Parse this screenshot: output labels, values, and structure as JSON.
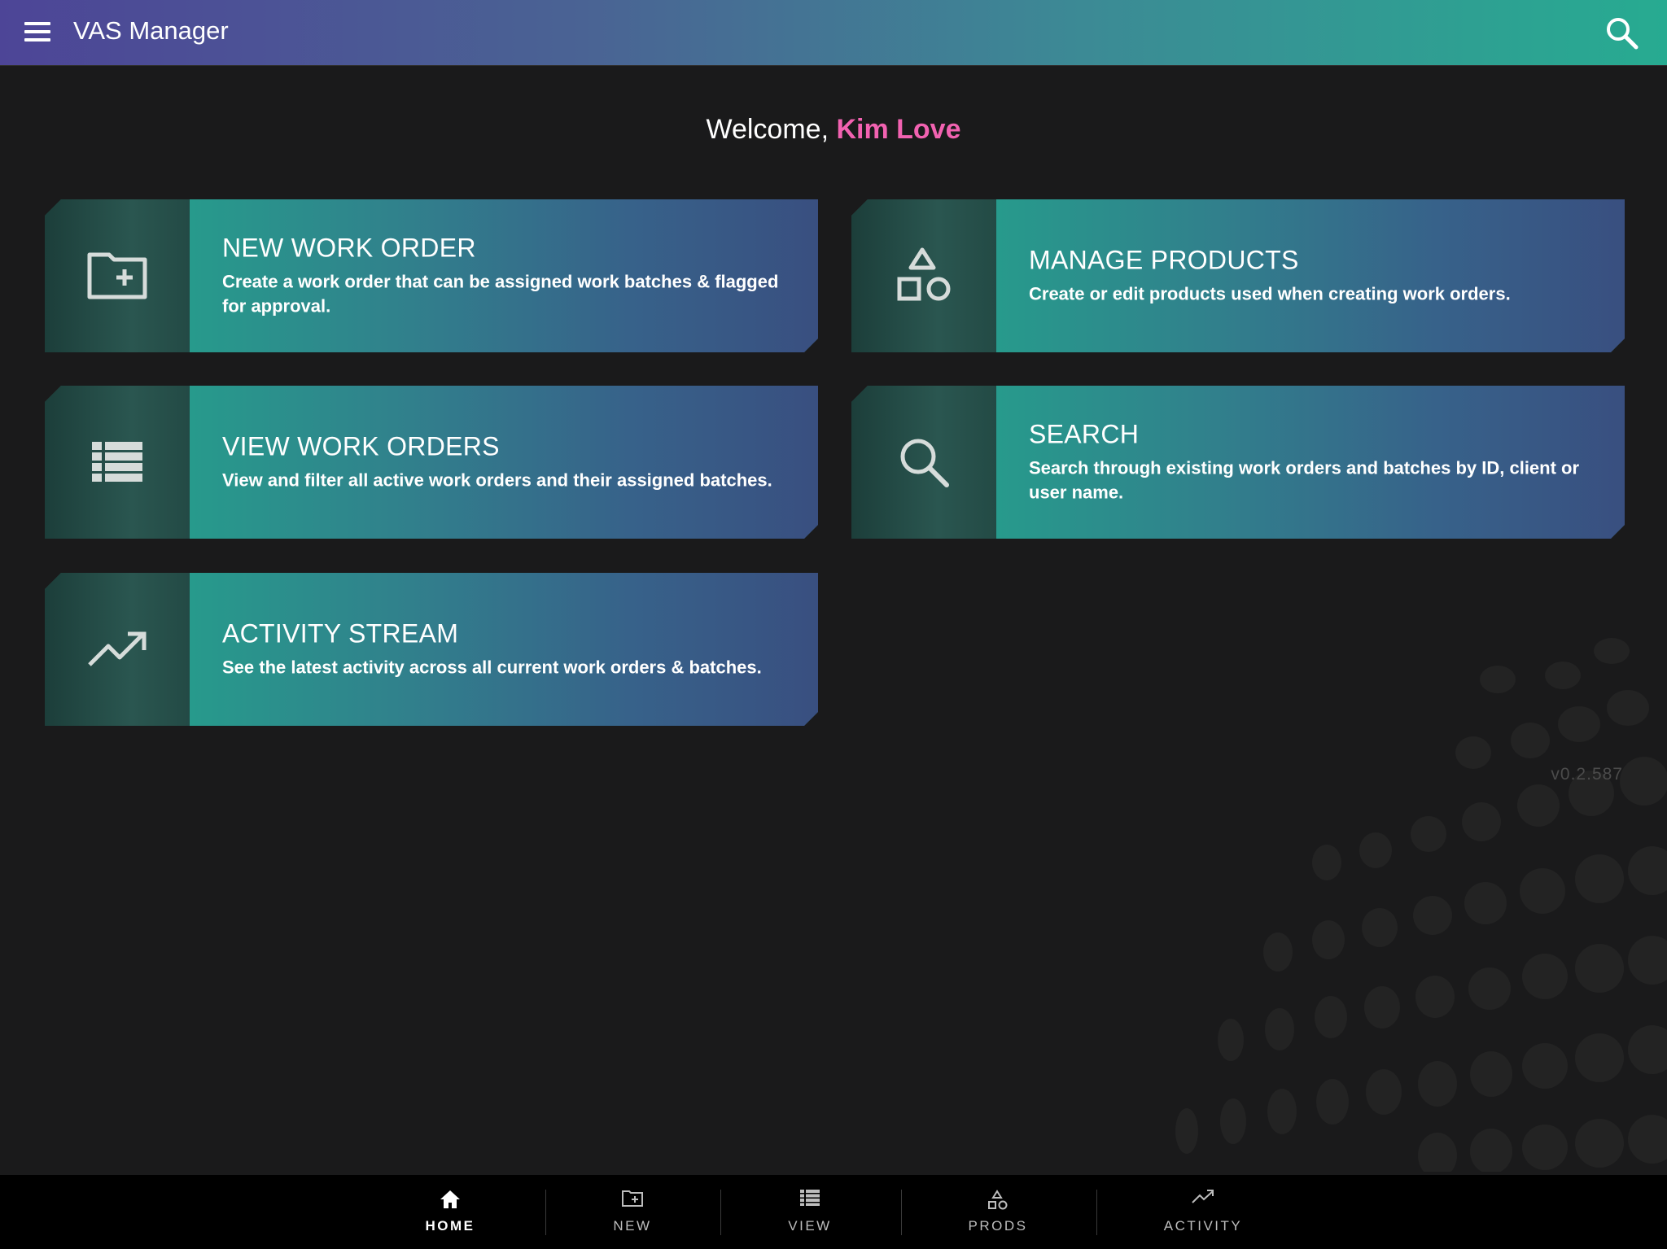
{
  "header": {
    "app_title": "VAS Manager",
    "menu_icon": "hamburger-menu-icon",
    "search_icon": "search-icon",
    "gradient_colors": [
      "#4d4597",
      "#27ab91"
    ]
  },
  "welcome": {
    "prefix": "Welcome,",
    "user_name": "Kim Love",
    "user_color": "#f262b1"
  },
  "tiles": [
    {
      "icon": "folder-plus-icon",
      "title": "NEW WORK ORDER",
      "description": "Create a work order that can be assigned work batches & flagged for approval."
    },
    {
      "icon": "shapes-icon",
      "title": "MANAGE PRODUCTS",
      "description": "Create or edit products used when creating work orders."
    },
    {
      "icon": "list-icon",
      "title": "VIEW WORK ORDERS",
      "description": "View and filter all active work orders and their assigned batches."
    },
    {
      "icon": "search-icon",
      "title": "SEARCH",
      "description": "Search through existing work orders and batches by ID, client or user name."
    },
    {
      "icon": "trending-up-icon",
      "title": "ACTIVITY STREAM",
      "description": "See the latest activity across all current work orders & batches."
    }
  ],
  "version": "v0.2.587",
  "bottom_nav": {
    "active": "HOME",
    "items": [
      {
        "label": "HOME",
        "icon": "home-icon"
      },
      {
        "label": "NEW",
        "icon": "folder-plus-icon"
      },
      {
        "label": "VIEW",
        "icon": "list-icon"
      },
      {
        "label": "PRODS",
        "icon": "shapes-icon"
      },
      {
        "label": "ACTIVITY",
        "icon": "trending-up-icon"
      }
    ]
  }
}
